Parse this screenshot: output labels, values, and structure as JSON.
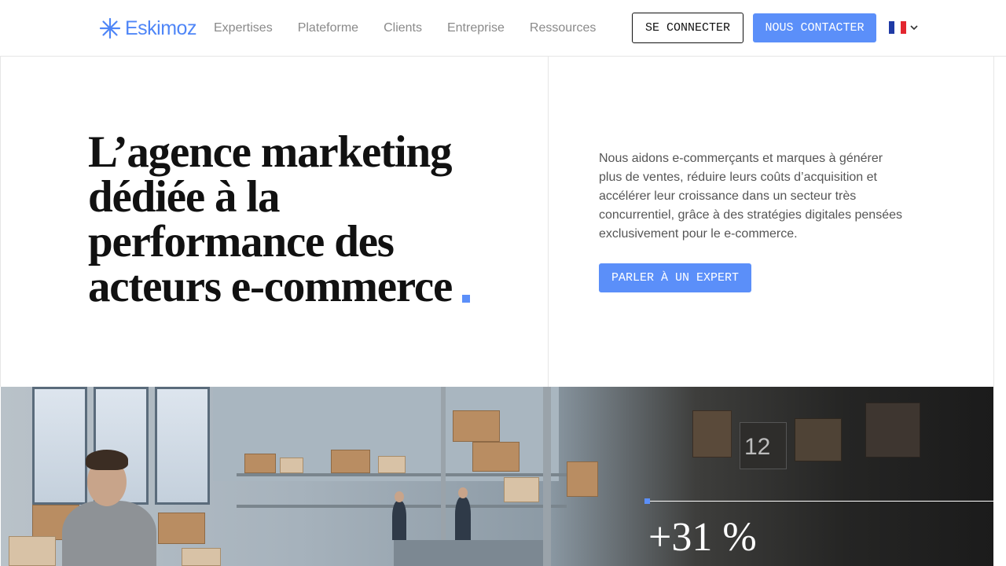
{
  "header": {
    "logo_text": "Eskimoz",
    "nav": [
      "Expertises",
      "Plateforme",
      "Clients",
      "Entreprise",
      "Ressources"
    ],
    "login_label": "SE CONNECTER",
    "contact_label": "NOUS CONTACTER",
    "language_icon": "france-flag-icon"
  },
  "hero": {
    "title_lines": [
      "L’agence marketing",
      "dédiée à la",
      "performance des",
      "acteurs e-commerce"
    ],
    "description": "Nous aidons e-commerçants et marques à générer plus de ventes, réduire leurs coûts d’acquisition et accélérer leur croissance dans un secteur très concurrentiel, grâce à des stratégies digitales pensées exclusivement pour le e-commerce.",
    "cta_label": "PARLER À UN EXPERT"
  },
  "stat": {
    "value": "+31 %"
  },
  "colors": {
    "accent": "#5b8ff9",
    "text": "#111111",
    "muted": "#8a8a8a"
  }
}
